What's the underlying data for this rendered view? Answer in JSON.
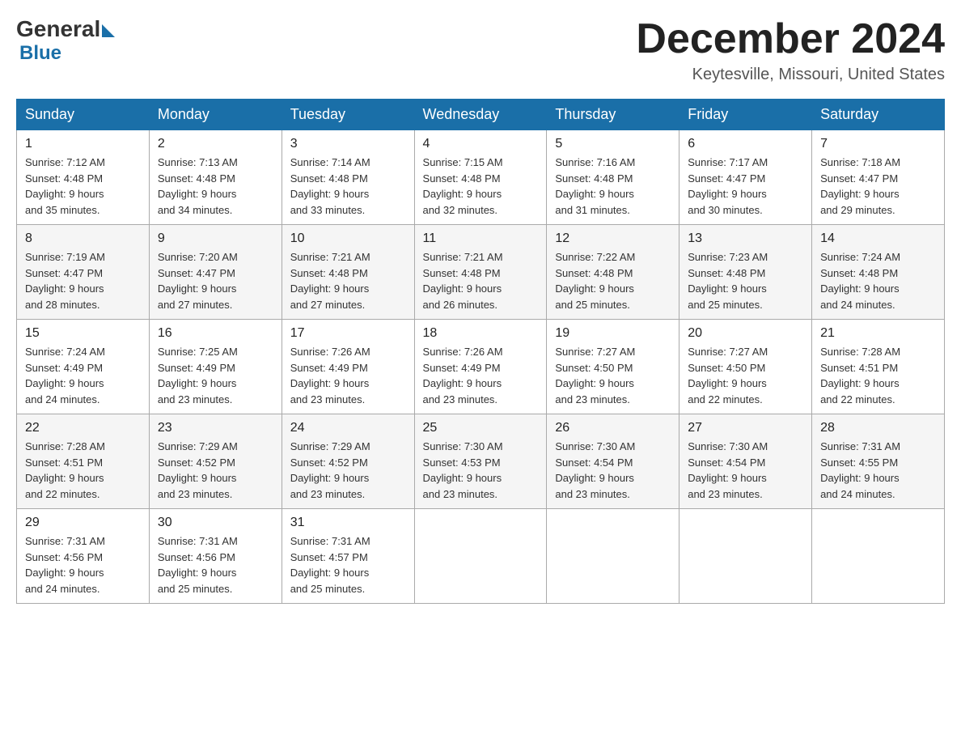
{
  "logo": {
    "general": "General",
    "blue": "Blue",
    "line2": "Blue"
  },
  "header": {
    "month_title": "December 2024",
    "location": "Keytesville, Missouri, United States"
  },
  "days_of_week": [
    "Sunday",
    "Monday",
    "Tuesday",
    "Wednesday",
    "Thursday",
    "Friday",
    "Saturday"
  ],
  "weeks": [
    [
      {
        "day": "1",
        "sunrise": "7:12 AM",
        "sunset": "4:48 PM",
        "daylight": "9 hours and 35 minutes."
      },
      {
        "day": "2",
        "sunrise": "7:13 AM",
        "sunset": "4:48 PM",
        "daylight": "9 hours and 34 minutes."
      },
      {
        "day": "3",
        "sunrise": "7:14 AM",
        "sunset": "4:48 PM",
        "daylight": "9 hours and 33 minutes."
      },
      {
        "day": "4",
        "sunrise": "7:15 AM",
        "sunset": "4:48 PM",
        "daylight": "9 hours and 32 minutes."
      },
      {
        "day": "5",
        "sunrise": "7:16 AM",
        "sunset": "4:48 PM",
        "daylight": "9 hours and 31 minutes."
      },
      {
        "day": "6",
        "sunrise": "7:17 AM",
        "sunset": "4:47 PM",
        "daylight": "9 hours and 30 minutes."
      },
      {
        "day": "7",
        "sunrise": "7:18 AM",
        "sunset": "4:47 PM",
        "daylight": "9 hours and 29 minutes."
      }
    ],
    [
      {
        "day": "8",
        "sunrise": "7:19 AM",
        "sunset": "4:47 PM",
        "daylight": "9 hours and 28 minutes."
      },
      {
        "day": "9",
        "sunrise": "7:20 AM",
        "sunset": "4:47 PM",
        "daylight": "9 hours and 27 minutes."
      },
      {
        "day": "10",
        "sunrise": "7:21 AM",
        "sunset": "4:48 PM",
        "daylight": "9 hours and 27 minutes."
      },
      {
        "day": "11",
        "sunrise": "7:21 AM",
        "sunset": "4:48 PM",
        "daylight": "9 hours and 26 minutes."
      },
      {
        "day": "12",
        "sunrise": "7:22 AM",
        "sunset": "4:48 PM",
        "daylight": "9 hours and 25 minutes."
      },
      {
        "day": "13",
        "sunrise": "7:23 AM",
        "sunset": "4:48 PM",
        "daylight": "9 hours and 25 minutes."
      },
      {
        "day": "14",
        "sunrise": "7:24 AM",
        "sunset": "4:48 PM",
        "daylight": "9 hours and 24 minutes."
      }
    ],
    [
      {
        "day": "15",
        "sunrise": "7:24 AM",
        "sunset": "4:49 PM",
        "daylight": "9 hours and 24 minutes."
      },
      {
        "day": "16",
        "sunrise": "7:25 AM",
        "sunset": "4:49 PM",
        "daylight": "9 hours and 23 minutes."
      },
      {
        "day": "17",
        "sunrise": "7:26 AM",
        "sunset": "4:49 PM",
        "daylight": "9 hours and 23 minutes."
      },
      {
        "day": "18",
        "sunrise": "7:26 AM",
        "sunset": "4:49 PM",
        "daylight": "9 hours and 23 minutes."
      },
      {
        "day": "19",
        "sunrise": "7:27 AM",
        "sunset": "4:50 PM",
        "daylight": "9 hours and 23 minutes."
      },
      {
        "day": "20",
        "sunrise": "7:27 AM",
        "sunset": "4:50 PM",
        "daylight": "9 hours and 22 minutes."
      },
      {
        "day": "21",
        "sunrise": "7:28 AM",
        "sunset": "4:51 PM",
        "daylight": "9 hours and 22 minutes."
      }
    ],
    [
      {
        "day": "22",
        "sunrise": "7:28 AM",
        "sunset": "4:51 PM",
        "daylight": "9 hours and 22 minutes."
      },
      {
        "day": "23",
        "sunrise": "7:29 AM",
        "sunset": "4:52 PM",
        "daylight": "9 hours and 23 minutes."
      },
      {
        "day": "24",
        "sunrise": "7:29 AM",
        "sunset": "4:52 PM",
        "daylight": "9 hours and 23 minutes."
      },
      {
        "day": "25",
        "sunrise": "7:30 AM",
        "sunset": "4:53 PM",
        "daylight": "9 hours and 23 minutes."
      },
      {
        "day": "26",
        "sunrise": "7:30 AM",
        "sunset": "4:54 PM",
        "daylight": "9 hours and 23 minutes."
      },
      {
        "day": "27",
        "sunrise": "7:30 AM",
        "sunset": "4:54 PM",
        "daylight": "9 hours and 23 minutes."
      },
      {
        "day": "28",
        "sunrise": "7:31 AM",
        "sunset": "4:55 PM",
        "daylight": "9 hours and 24 minutes."
      }
    ],
    [
      {
        "day": "29",
        "sunrise": "7:31 AM",
        "sunset": "4:56 PM",
        "daylight": "9 hours and 24 minutes."
      },
      {
        "day": "30",
        "sunrise": "7:31 AM",
        "sunset": "4:56 PM",
        "daylight": "9 hours and 25 minutes."
      },
      {
        "day": "31",
        "sunrise": "7:31 AM",
        "sunset": "4:57 PM",
        "daylight": "9 hours and 25 minutes."
      },
      null,
      null,
      null,
      null
    ]
  ],
  "labels": {
    "sunrise": "Sunrise:",
    "sunset": "Sunset:",
    "daylight": "Daylight:"
  }
}
